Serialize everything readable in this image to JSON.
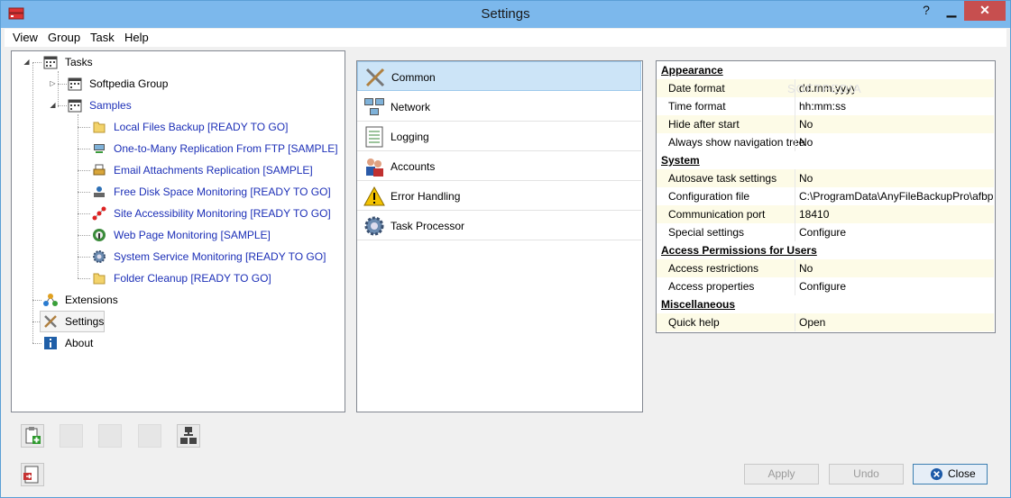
{
  "window": {
    "title": "Settings"
  },
  "menu": [
    "View",
    "Group",
    "Task",
    "Help"
  ],
  "tree": {
    "tasks": "Tasks",
    "softpedia_group": "Softpedia Group",
    "samples": "Samples",
    "sample_items": [
      "Local Files Backup [READY TO GO]",
      "One-to-Many Replication From FTP [SAMPLE]",
      "Email Attachments Replication [SAMPLE]",
      "Free Disk Space Monitoring [READY TO GO]",
      "Site Accessibility Monitoring [READY TO GO]",
      "Web Page Monitoring [SAMPLE]",
      "System Service Monitoring [READY TO GO]",
      "Folder Cleanup [READY TO GO]"
    ],
    "extensions": "Extensions",
    "settings": "Settings",
    "about": "About"
  },
  "categories": [
    "Common",
    "Network",
    "Logging",
    "Accounts",
    "Error Handling",
    "Task Processor"
  ],
  "properties": {
    "appearance": "Appearance",
    "date_format_k": "Date format",
    "date_format_v": "dd.mm.yyyy",
    "time_format_k": "Time format",
    "time_format_v": "hh:mm:ss",
    "hide_after_start_k": "Hide after start",
    "hide_after_start_v": "No",
    "always_show_nav_k": "Always show navigation tree",
    "always_show_nav_v": "No",
    "system": "System",
    "autosave_k": "Autosave task settings",
    "autosave_v": "No",
    "config_file_k": "Configuration file",
    "config_file_v": "C:\\ProgramData\\AnyFileBackupPro\\afbpro.da",
    "comm_port_k": "Communication port",
    "comm_port_v": "18410",
    "special_k": "Special settings",
    "special_v": "Configure",
    "access_permissions": "Access Permissions for Users",
    "access_restrictions_k": "Access restrictions",
    "access_restrictions_v": "No",
    "access_properties_k": "Access properties",
    "access_properties_v": "Configure",
    "misc": "Miscellaneous",
    "quick_help_k": "Quick help",
    "quick_help_v": "Open"
  },
  "watermark": "SOFTPEDIA",
  "buttons": {
    "apply": "Apply",
    "undo": "Undo",
    "close": "Close"
  }
}
